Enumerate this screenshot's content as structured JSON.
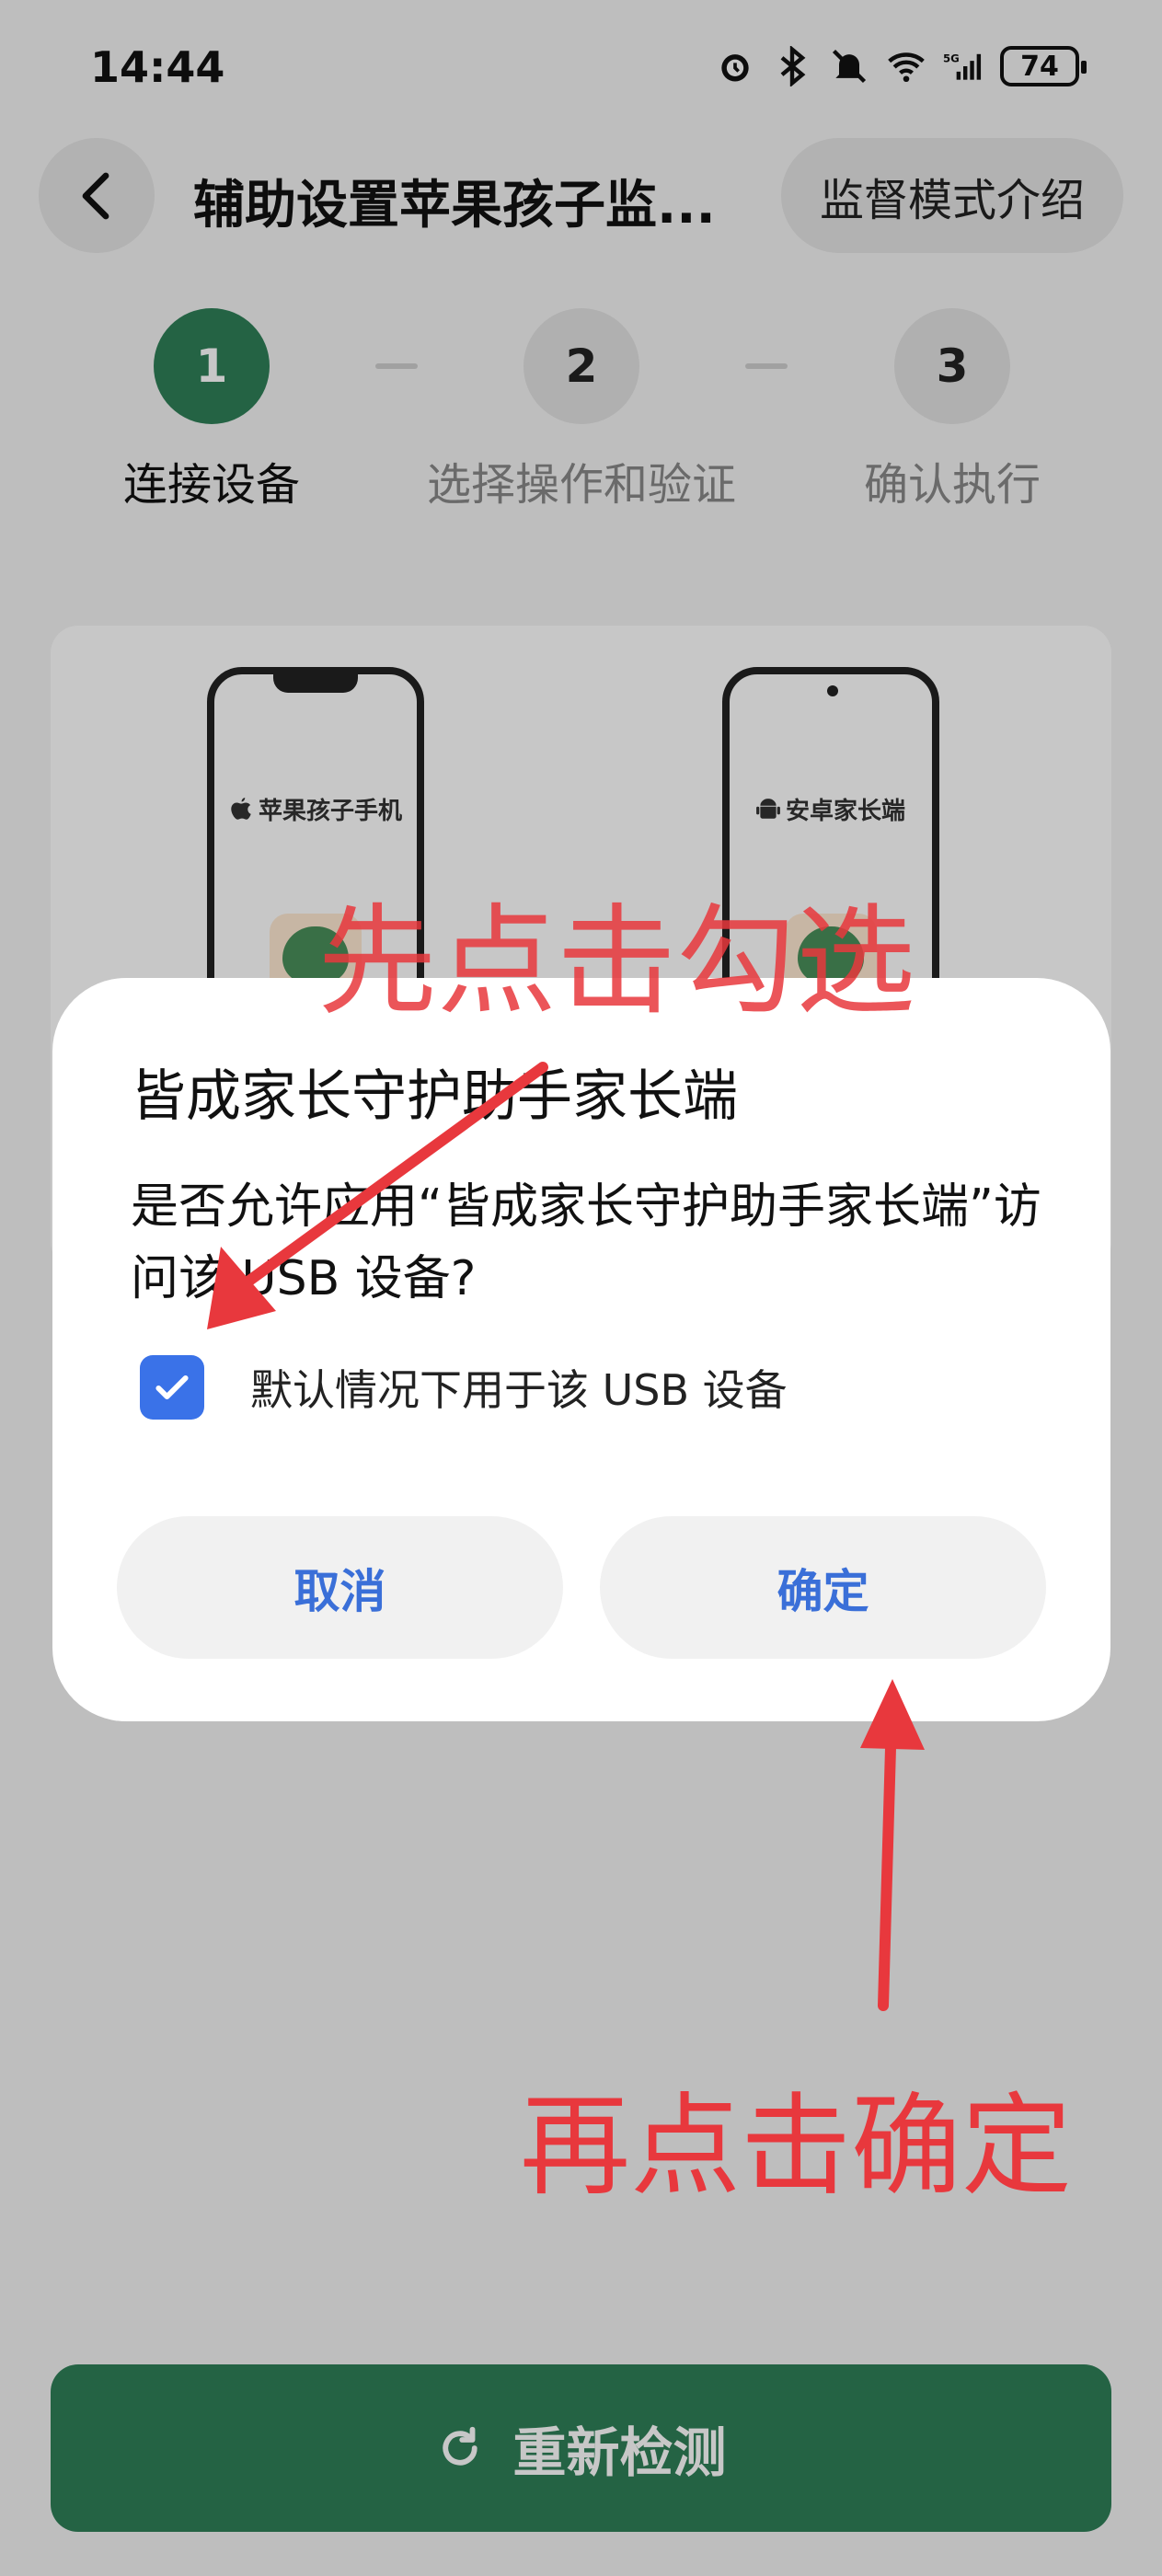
{
  "status_bar": {
    "time": "14:44",
    "battery": "74",
    "icons": [
      "alarm-icon",
      "bluetooth-icon",
      "mute-icon",
      "wifi-icon",
      "signal-5g-icon",
      "battery-icon"
    ]
  },
  "nav": {
    "back_icon": "chevron-left-icon",
    "title": "辅助设置苹果孩子监...",
    "intro_button": "监督模式介绍"
  },
  "steps": [
    {
      "number": "1",
      "label": "连接设备",
      "state": "active"
    },
    {
      "number": "2",
      "label": "选择操作和验证",
      "state": "pending"
    },
    {
      "number": "3",
      "label": "确认执行",
      "state": "pending"
    }
  ],
  "illustration": {
    "iphone_label": "苹果孩子手机",
    "android_label": "安卓家长端"
  },
  "dialog": {
    "title": "皆成家长守护助手家长端",
    "message": "是否允许应用“皆成家长守护助手家长端”访问该 USB 设备?",
    "checkbox_label": "默认情况下用于该 USB 设备",
    "checkbox_checked": true,
    "cancel_label": "取消",
    "ok_label": "确定"
  },
  "annotations": {
    "step1": "先点击勾选",
    "step2": "再点击确定",
    "color": "#e8383d"
  },
  "footer": {
    "refresh_icon": "refresh-icon",
    "restart_label": "重新检测"
  },
  "colors": {
    "primary_green": "#2f7f58",
    "dialog_accent": "#3a6fd8",
    "checkbox_blue": "#3a72e8"
  }
}
